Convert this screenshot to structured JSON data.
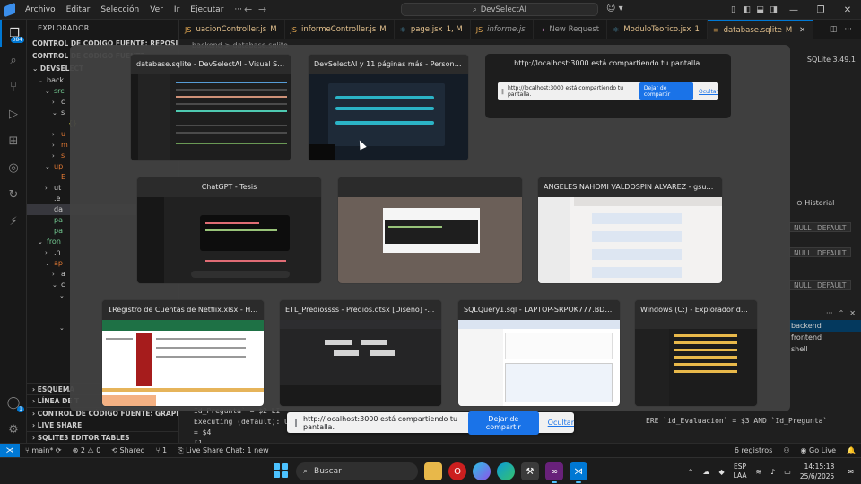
{
  "titlebar": {
    "menus": [
      "Archivo",
      "Editar",
      "Selección",
      "Ver",
      "Ir",
      "Ejecutar",
      "···"
    ],
    "command_center": "DevSelectAI"
  },
  "activity_bar": {
    "scm_badge": "384"
  },
  "sidebar": {
    "title": "EXPLORADOR",
    "sections_top": [
      "CONTROL DE CÓDIGO FUENTE: REPOSITORIOS",
      "CONTROL DE CÓDIGO FUENTE"
    ],
    "root": "DEVSELECT",
    "tree": [
      {
        "indent": 1,
        "chev": "v",
        "icon": "",
        "label": "back",
        "color": "#cccccc"
      },
      {
        "indent": 2,
        "chev": "v",
        "icon": "",
        "label": "src",
        "color": "#73c991"
      },
      {
        "indent": 3,
        "chev": ">",
        "icon": "",
        "label": "c",
        "color": "#cccccc"
      },
      {
        "indent": 3,
        "chev": "v",
        "icon": "",
        "label": "s",
        "color": "#cccccc"
      },
      {
        "indent": 4,
        "chev": "",
        "icon": "{}",
        "label": "",
        "color": "#cbcb41"
      },
      {
        "indent": 3,
        "chev": ">",
        "icon": "",
        "label": "u",
        "color": "#e37933"
      },
      {
        "indent": 3,
        "chev": ">",
        "icon": "",
        "label": "m",
        "color": "#e37933"
      },
      {
        "indent": 3,
        "chev": ">",
        "icon": "",
        "label": "s",
        "color": "#e37933"
      },
      {
        "indent": 2,
        "chev": "v",
        "icon": "",
        "label": "up",
        "color": "#e37933"
      },
      {
        "indent": 3,
        "chev": "",
        "icon": "",
        "label": "E",
        "color": "#e37933"
      },
      {
        "indent": 2,
        "chev": ">",
        "icon": "",
        "label": "ut",
        "color": "#cccccc"
      },
      {
        "indent": 2,
        "chev": "",
        "icon": "",
        "label": ".e",
        "color": "#cccccc"
      },
      {
        "indent": 2,
        "chev": "",
        "icon": "",
        "label": "da",
        "color": "#cccccc",
        "selected": true
      },
      {
        "indent": 2,
        "chev": "",
        "icon": "",
        "label": "pa",
        "color": "#73c991"
      },
      {
        "indent": 2,
        "chev": "",
        "icon": "",
        "label": "pa",
        "color": "#73c991"
      },
      {
        "indent": 1,
        "chev": "v",
        "icon": "",
        "label": "fron",
        "color": "#73c991"
      },
      {
        "indent": 2,
        "chev": ">",
        "icon": "",
        "label": ".n",
        "color": "#cccccc"
      },
      {
        "indent": 2,
        "chev": "v",
        "icon": "",
        "label": "ap",
        "color": "#e37933"
      },
      {
        "indent": 3,
        "chev": ">",
        "icon": "",
        "label": "a",
        "color": "#cccccc"
      },
      {
        "indent": 3,
        "chev": "v",
        "icon": "",
        "label": "c",
        "color": "#cccccc"
      },
      {
        "indent": 4,
        "chev": "v",
        "icon": "",
        "label": "",
        "color": "#cccccc"
      },
      {
        "indent": 5,
        "chev": "",
        "icon": "",
        "label": "",
        "color": "#519aba"
      },
      {
        "indent": 5,
        "chev": "",
        "icon": "",
        "label": "",
        "color": "#519aba"
      },
      {
        "indent": 4,
        "chev": "v",
        "icon": "",
        "label": "",
        "color": "#cccccc"
      }
    ],
    "sections_bottom": [
      "ESQUEMA",
      "LÍNEA DE T",
      "CONTROL DE CÓDIGO FUENTE: GRAPH",
      "LIVE SHARE",
      "SQLITE3 EDITOR TABLES"
    ]
  },
  "tabs": [
    {
      "label": "uacionController.js",
      "badge": "M",
      "icon": "JS",
      "color": "#e8ab53",
      "active": false
    },
    {
      "label": "informeController.js",
      "badge": "M",
      "icon": "JS",
      "color": "#e8ab53",
      "active": false
    },
    {
      "label": "page.jsx",
      "badge": "1, M",
      "icon": "⚛",
      "color": "#519aba",
      "active": false
    },
    {
      "label": "informe.js",
      "badge": "",
      "icon": "JS",
      "color": "#e8ab53",
      "active": false,
      "italic": true
    },
    {
      "label": "New Request",
      "badge": "",
      "icon": "⇢",
      "color": "#c586c0",
      "active": false
    },
    {
      "label": "ModuloTeorico.jsx",
      "badge": "1",
      "icon": "⚛",
      "color": "#519aba",
      "active": false
    },
    {
      "label": "database.sqlite",
      "badge": "M",
      "icon": "≡",
      "color": "#e8ab53",
      "active": true
    }
  ],
  "editor": {
    "breadcrumb": "backend > database.sqlite",
    "sqlite_version": "SQLite 3.49.1",
    "historial": "Historial",
    "grid_cells": [
      "NULL",
      "DEFAULT",
      "NULL",
      "DEFAULT",
      "NULL",
      "DEFAULT"
    ],
    "panel_files": [
      "backend",
      "frontend",
      "shell"
    ],
    "terminal": [
      "  Id_Pregunta` = $2 LI",
      "Executing (default): UP",
      "  = $4",
      "[]"
    ],
    "terminal_fragment": "ERE `id_Evaluacion` = $3 AND `Id_Pregunta`"
  },
  "share_picker": {
    "windows": [
      {
        "title": "database.sqlite - DevSelectAI - Visual Studi...",
        "kind": "vscode"
      },
      {
        "title": "DevSelectAI y 11 páginas más - Personal: Mi...",
        "kind": "browser-dark"
      },
      {
        "title": "ChatGPT - Tesis",
        "kind": "chat"
      },
      {
        "title": "",
        "kind": "blank"
      },
      {
        "title": "ANGELES NAHOMI VALDOSPIN ALVAREZ - gsuarez...",
        "kind": "mail"
      },
      {
        "title": "1Registro de Cuentas de Netflix.xlsx - Hojas...",
        "kind": "sheet"
      },
      {
        "title": "ETL_Prediossss - Predios.dtsx [Diseño] - Micr...",
        "kind": "ssis"
      },
      {
        "title": "SQLQuery1.sql - LAPTOP-SRPOK777.BD_PR...",
        "kind": "sql"
      },
      {
        "title": "Windows (C:) - Explorador de...",
        "kind": "explorer"
      }
    ],
    "share_card": {
      "title": "http://localhost:3000 está compartiendo tu pantalla.",
      "inner_text": "http://localhost:3000 está compartiendo tu pantalla.",
      "stop_label": "Dejar de compartir",
      "hide_label": "Ocultar"
    }
  },
  "sharebar": {
    "text": "http://localhost:3000 está compartiendo tu pantalla.",
    "stop_label": "Dejar de compartir",
    "hide_label": "Ocultar"
  },
  "statusbar": {
    "branch": "main*",
    "sync": "⟳",
    "problems": "⊗ 2 ⚠ 0",
    "shared": "Shared",
    "ports": "⑂ 1",
    "liveshare_chat": "Live Share Chat: 1 new",
    "records": "6 registros",
    "golive": "Go Live"
  },
  "taskbar": {
    "search_label": "Buscar",
    "lang_top": "ESP",
    "lang_bottom": "LAA",
    "time": "14:15:18",
    "date": "25/6/2025"
  }
}
